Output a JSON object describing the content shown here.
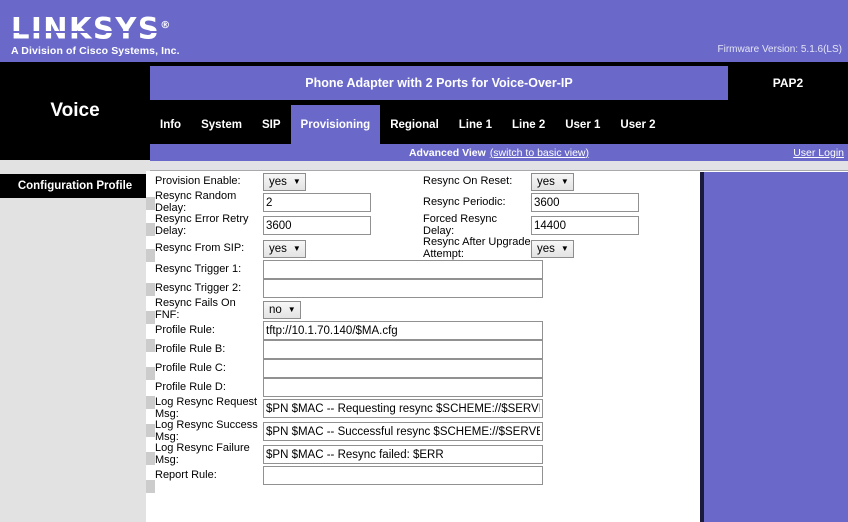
{
  "banner": {
    "brand": "LINKSYS",
    "registered_mark": "®",
    "tagline": "A Division of Cisco Systems, Inc.",
    "firmware": "Firmware Version: 5.1.6(LS)",
    "accent_color": "#6a69ca"
  },
  "header": {
    "product_title": "Phone Adapter with 2 Ports for Voice-Over-IP",
    "model": "PAP2",
    "device_section": "Voice"
  },
  "tabs": [
    {
      "label": "Info",
      "active": false
    },
    {
      "label": "System",
      "active": false
    },
    {
      "label": "SIP",
      "active": false
    },
    {
      "label": "Provisioning",
      "active": true
    },
    {
      "label": "Regional",
      "active": false
    },
    {
      "label": "Line 1",
      "active": false
    },
    {
      "label": "Line 2",
      "active": false
    },
    {
      "label": "User 1",
      "active": false
    },
    {
      "label": "User 2",
      "active": false
    }
  ],
  "viewbar": {
    "mode_label": "Advanced View",
    "switch_link": "(switch to basic view)",
    "user_login": "User Login"
  },
  "sidebar": {
    "section_title": "Configuration Profile"
  },
  "form": {
    "rows": [
      {
        "left": {
          "label": "Provision Enable:",
          "type": "select",
          "value": "yes"
        },
        "right": {
          "label": "Resync On Reset:",
          "type": "select",
          "value": "yes"
        }
      },
      {
        "left": {
          "label": "Resync Random Delay:",
          "type": "text",
          "value": "2"
        },
        "right": {
          "label": "Resync Periodic:",
          "type": "text",
          "value": "3600"
        }
      },
      {
        "left": {
          "label": "Resync Error Retry Delay:",
          "type": "text",
          "value": "3600"
        },
        "right": {
          "label": "Forced Resync Delay:",
          "type": "text",
          "value": "14400"
        }
      },
      {
        "left": {
          "label": "Resync From SIP:",
          "type": "select",
          "value": "yes"
        },
        "right": {
          "label": "Resync After Upgrade Attempt:",
          "type": "select",
          "value": "yes"
        }
      }
    ],
    "wide_rows": [
      {
        "label": "Resync Trigger 1:",
        "type": "text",
        "value": ""
      },
      {
        "label": "Resync Trigger 2:",
        "type": "text",
        "value": ""
      },
      {
        "label": "Resync Fails On FNF:",
        "type": "select",
        "value": "no"
      },
      {
        "label": "Profile Rule:",
        "type": "text",
        "value": "tftp://10.1.70.140/$MA.cfg"
      },
      {
        "label": "Profile Rule B:",
        "type": "text",
        "value": ""
      },
      {
        "label": "Profile Rule C:",
        "type": "text",
        "value": ""
      },
      {
        "label": "Profile Rule D:",
        "type": "text",
        "value": ""
      },
      {
        "label": "Log Resync Request Msg:",
        "type": "text",
        "value": "$PN $MAC -- Requesting resync $SCHEME://$SERVER"
      },
      {
        "label": "Log Resync Success Msg:",
        "type": "text",
        "value": "$PN $MAC -- Successful resync $SCHEME://$SERVER"
      },
      {
        "label": "Log Resync Failure Msg:",
        "type": "text",
        "value": "$PN $MAC -- Resync failed: $ERR"
      },
      {
        "label": "Report Rule:",
        "type": "text",
        "value": ""
      }
    ]
  }
}
